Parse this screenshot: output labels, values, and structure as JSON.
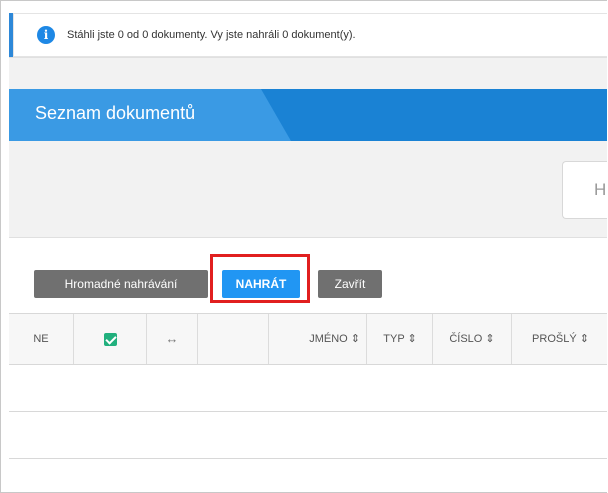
{
  "notice": {
    "icon": "info-icon",
    "message": "Stáhli jste 0 od 0 dokumenty. Vy jste nahráli 0 dokument(y)."
  },
  "header": {
    "title": "Seznam dokumentů"
  },
  "search": {
    "placeholder_fragment": "Hl"
  },
  "toolbar": {
    "mass_upload": "Hromadné nahrávání",
    "upload": "NAHRÁT",
    "close": "Zavřít"
  },
  "table": {
    "columns": {
      "no": "NE",
      "select": "checkbox-checked-icon",
      "expand": "↔",
      "blank": "",
      "name": "JMÉNO ⇕",
      "type": "TYP ⇕",
      "number": "ČÍSLO ⇕",
      "expired": "PROŠLÝ ⇕"
    },
    "rows": 3
  },
  "colors": {
    "accent": "#1a82d4",
    "upload_button": "#2196f3",
    "highlight": "#e11f1f",
    "checkbox": "#21b07d"
  }
}
